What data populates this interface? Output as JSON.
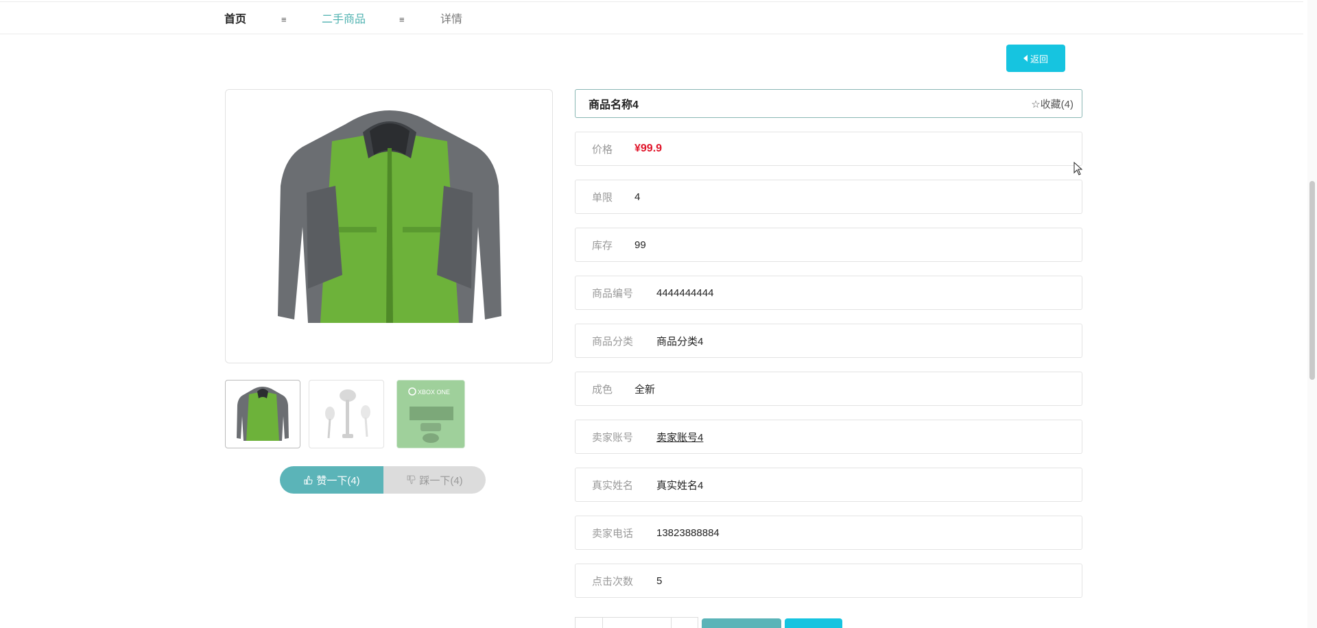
{
  "breadcrumb": {
    "home": "首页",
    "separator": "≡",
    "category": "二手商品",
    "current": "详情"
  },
  "back_button": {
    "label": "返回"
  },
  "product": {
    "name": "商品名称4",
    "favorite_label": "☆收藏(4)",
    "fields": [
      {
        "label": "价格",
        "value": "¥99.9"
      },
      {
        "label": "单限",
        "value": "4"
      },
      {
        "label": "库存",
        "value": "99"
      },
      {
        "label": "商品编号",
        "value": "4444444444"
      },
      {
        "label": "商品分类",
        "value": "商品分类4"
      },
      {
        "label": "成色",
        "value": "全新"
      },
      {
        "label": "卖家账号",
        "value": "卖家账号4"
      },
      {
        "label": "真实姓名",
        "value": "真实姓名4"
      },
      {
        "label": "卖家电话",
        "value": "13823888884"
      },
      {
        "label": "点击次数",
        "value": "5"
      }
    ]
  },
  "votes": {
    "like_label": "赞一下(4)",
    "dislike_label": "踩一下(4)"
  },
  "thumbnails": {
    "xbox_text": "XBOX ONE"
  },
  "colors": {
    "accent_teal": "#5bb4b8",
    "accent_cyan": "#16c4e0",
    "price_red": "#e0152a"
  },
  "icons": {
    "back": "caret-left-icon",
    "like": "thumbs-up-icon",
    "dislike": "thumbs-down-icon",
    "favorite": "star-outline-icon",
    "cursor": "mouse-pointer-icon"
  }
}
